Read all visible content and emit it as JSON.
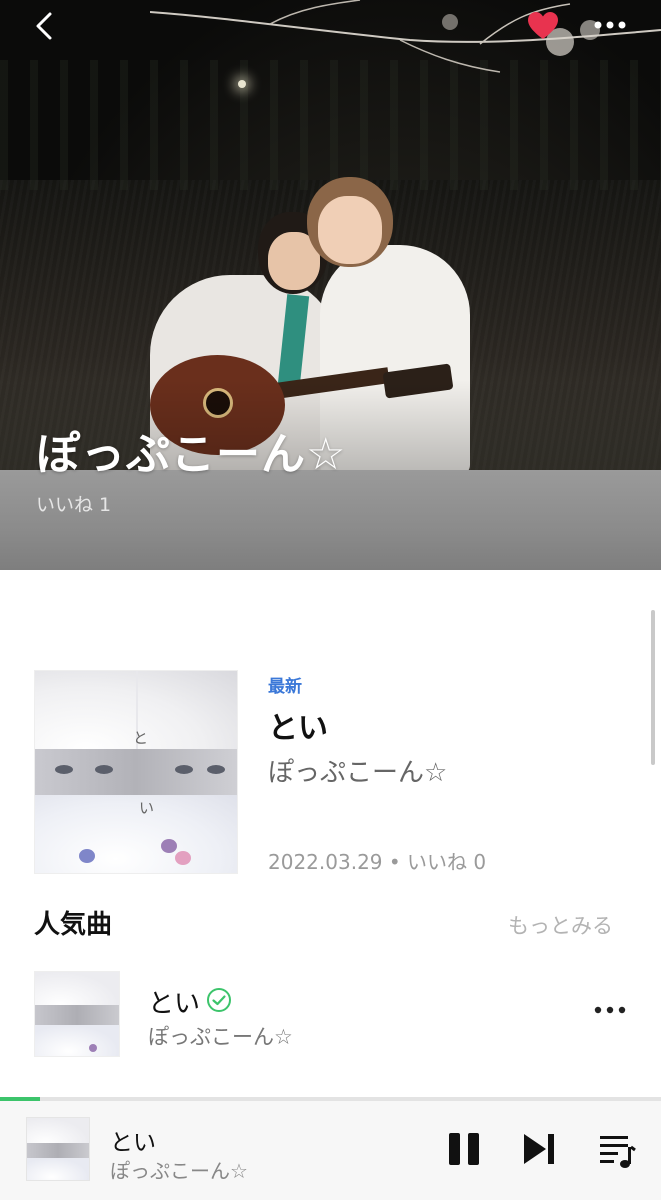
{
  "header": {
    "artist_name": "ぽっぷこーん☆",
    "likes_label": "いいね 1",
    "icons": [
      "back-arrow-icon",
      "heart-icon",
      "more-horizontal-icon"
    ],
    "accent_heart": "#e8334f"
  },
  "latest": {
    "tag": "最新",
    "song_title": "とい",
    "artist": "ぽっぷこーん☆",
    "meta": "2022.03.29 • いいね 0",
    "art_chars": [
      "と",
      "い"
    ],
    "tag_color": "#3b78d8"
  },
  "popular": {
    "section_title": "人気曲",
    "see_more": "もっとみる",
    "tracks": [
      {
        "title": "とい",
        "artist": "ぽっぷこーん☆",
        "icon": "verified-check-icon"
      }
    ]
  },
  "player": {
    "title": "とい",
    "artist": "ぽっぷこーん☆",
    "progress": 0.06,
    "accent": "#3cc46b",
    "icons": [
      "pause-icon",
      "skip-next-icon",
      "queue-music-icon"
    ]
  }
}
